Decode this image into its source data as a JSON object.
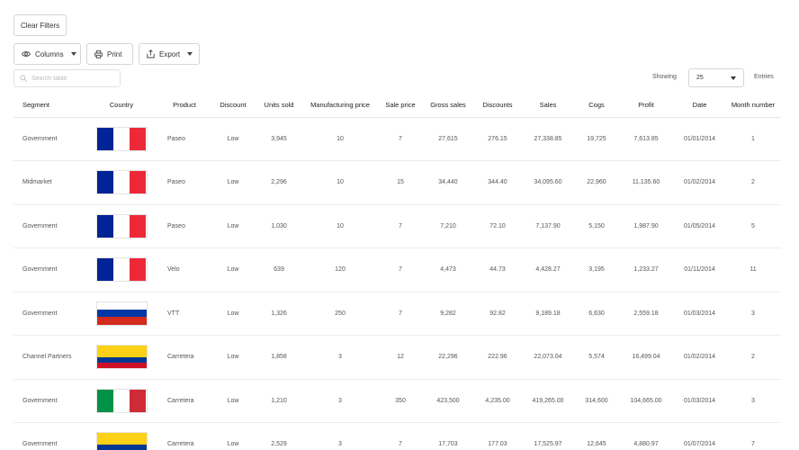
{
  "toolbar": {
    "clear_filters": "Clear Filters",
    "columns": "Columns",
    "print": "Print",
    "export": "Export"
  },
  "search": {
    "placeholder": "Search table",
    "value": ""
  },
  "pagination": {
    "showing_label": "Showing",
    "page_size": "25",
    "entries_label": "Entries"
  },
  "columns": [
    "Segment",
    "Country",
    "Product",
    "Discount",
    "Units sold",
    "Manufacturing price",
    "Sale price",
    "Gross sales",
    "Discounts",
    "Sales",
    "Cogs",
    "Profit",
    "Date",
    "Month number"
  ],
  "flags": {
    "france": [
      "#002395",
      "#ffffff",
      "#ED2939"
    ],
    "russia": [
      "#ffffff",
      "#0039A6",
      "#D52B1E"
    ],
    "colombia": [
      "#FCD116",
      "#FCD116",
      "#003893",
      "#CE1126"
    ],
    "italy": [
      "#009246",
      "#ffffff",
      "#CE2B37"
    ]
  },
  "rows": [
    {
      "segment": "Government",
      "flag": "france",
      "product": "Paseo",
      "discount": "Low",
      "units": "3,945",
      "mfg": "10",
      "sale": "7",
      "gross": "27,615",
      "discounts": "276.15",
      "sales": "27,338.85",
      "cogs": "19,725",
      "profit": "7,613.85",
      "date": "01/01/2014",
      "month": "1"
    },
    {
      "segment": "Midmarket",
      "flag": "france",
      "product": "Paseo",
      "discount": "Low",
      "units": "2,296",
      "mfg": "10",
      "sale": "15",
      "gross": "34,440",
      "discounts": "344.40",
      "sales": "34,095.60",
      "cogs": "22,960",
      "profit": "11,135.60",
      "date": "01/02/2014",
      "month": "2"
    },
    {
      "segment": "Government",
      "flag": "france",
      "product": "Paseo",
      "discount": "Low",
      "units": "1,030",
      "mfg": "10",
      "sale": "7",
      "gross": "7,210",
      "discounts": "72.10",
      "sales": "7,137.90",
      "cogs": "5,150",
      "profit": "1,987.90",
      "date": "01/05/2014",
      "month": "5"
    },
    {
      "segment": "Government",
      "flag": "france",
      "product": "Velo",
      "discount": "Low",
      "units": "639",
      "mfg": "120",
      "sale": "7",
      "gross": "4,473",
      "discounts": "44.73",
      "sales": "4,428.27",
      "cogs": "3,195",
      "profit": "1,233.27",
      "date": "01/11/2014",
      "month": "11"
    },
    {
      "segment": "Government",
      "flag": "russia",
      "product": "VTT",
      "discount": "Low",
      "units": "1,326",
      "mfg": "250",
      "sale": "7",
      "gross": "9,282",
      "discounts": "92.82",
      "sales": "9,189.18",
      "cogs": "6,630",
      "profit": "2,559.18",
      "date": "01/03/2014",
      "month": "3"
    },
    {
      "segment": "Channel Partners",
      "flag": "colombia",
      "product": "Carretera",
      "discount": "Low",
      "units": "1,858",
      "mfg": "3",
      "sale": "12",
      "gross": "22,296",
      "discounts": "222.96",
      "sales": "22,073.04",
      "cogs": "5,574",
      "profit": "16,499.04",
      "date": "01/02/2014",
      "month": "2"
    },
    {
      "segment": "Government",
      "flag": "italy",
      "product": "Carretera",
      "discount": "Low",
      "units": "1,210",
      "mfg": "3",
      "sale": "350",
      "gross": "423,500",
      "discounts": "4,235.00",
      "sales": "419,265.00",
      "cogs": "314,600",
      "profit": "104,665.00",
      "date": "01/03/2014",
      "month": "3"
    },
    {
      "segment": "Government",
      "flag": "colombia",
      "product": "Carretera",
      "discount": "Low",
      "units": "2,529",
      "mfg": "3",
      "sale": "7",
      "gross": "17,703",
      "discounts": "177.03",
      "sales": "17,525.97",
      "cogs": "12,645",
      "profit": "4,880.97",
      "date": "01/07/2014",
      "month": "7"
    }
  ]
}
